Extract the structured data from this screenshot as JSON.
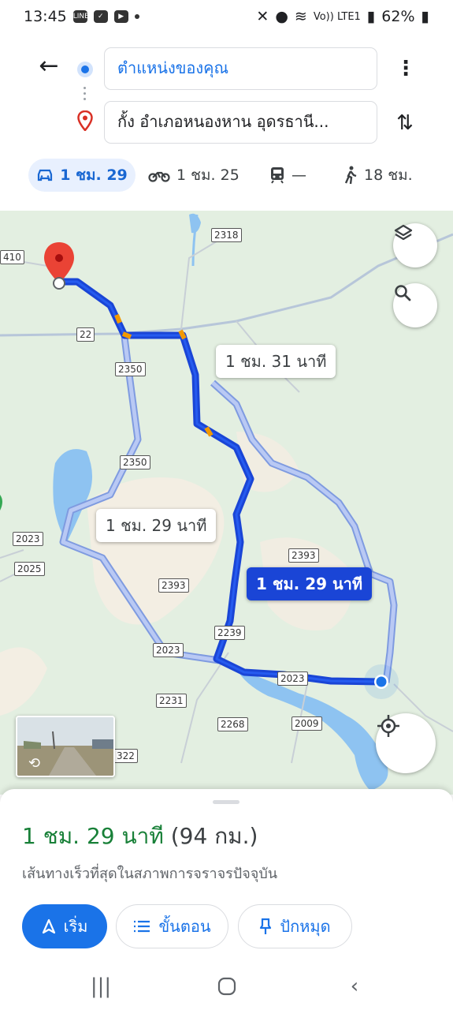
{
  "status_bar": {
    "time": "13:45",
    "battery": "62%",
    "network": "Vo)) LTE1"
  },
  "directions": {
    "origin_text": "ตำแหน่งของคุณ",
    "destination_text": "กั้ง อำเภอหนองหาน อุดรธานี...",
    "modes": [
      {
        "icon": "car-icon",
        "label": "1 ชม. 29",
        "selected": true
      },
      {
        "icon": "motorcycle-icon",
        "label": "1 ชม. 25",
        "selected": false
      },
      {
        "icon": "transit-icon",
        "label": "—",
        "selected": false
      },
      {
        "icon": "walk-icon",
        "label": "18 ชม.",
        "selected": false
      }
    ]
  },
  "map": {
    "road_signs": [
      "2318",
      "410",
      "22",
      "2350",
      "2350",
      "2023",
      "2025",
      "2393",
      "2393",
      "2239",
      "2023",
      "2023",
      "2231",
      "2268",
      "2009",
      "322"
    ],
    "callouts": {
      "alt_route_1": "1 ชม. 31 นาที",
      "alt_route_2": "1 ชม. 29 นาที",
      "selected_route": "1 ชม. 29 นาที"
    },
    "colors": {
      "selected_route": "#1a45d6",
      "alternate_route": "#9db3f0",
      "water": "#8ec3f1",
      "land": "#e3efe1"
    }
  },
  "sheet": {
    "duration": "1 ชม. 29 นาที",
    "distance": "(94 กม.)",
    "description": "เส้นทางเร็วที่สุดในสภาพการจราจรปัจจุบัน",
    "start_label": "เริ่ม",
    "steps_label": "ขั้นตอน",
    "pin_label": "ปักหมุด"
  }
}
